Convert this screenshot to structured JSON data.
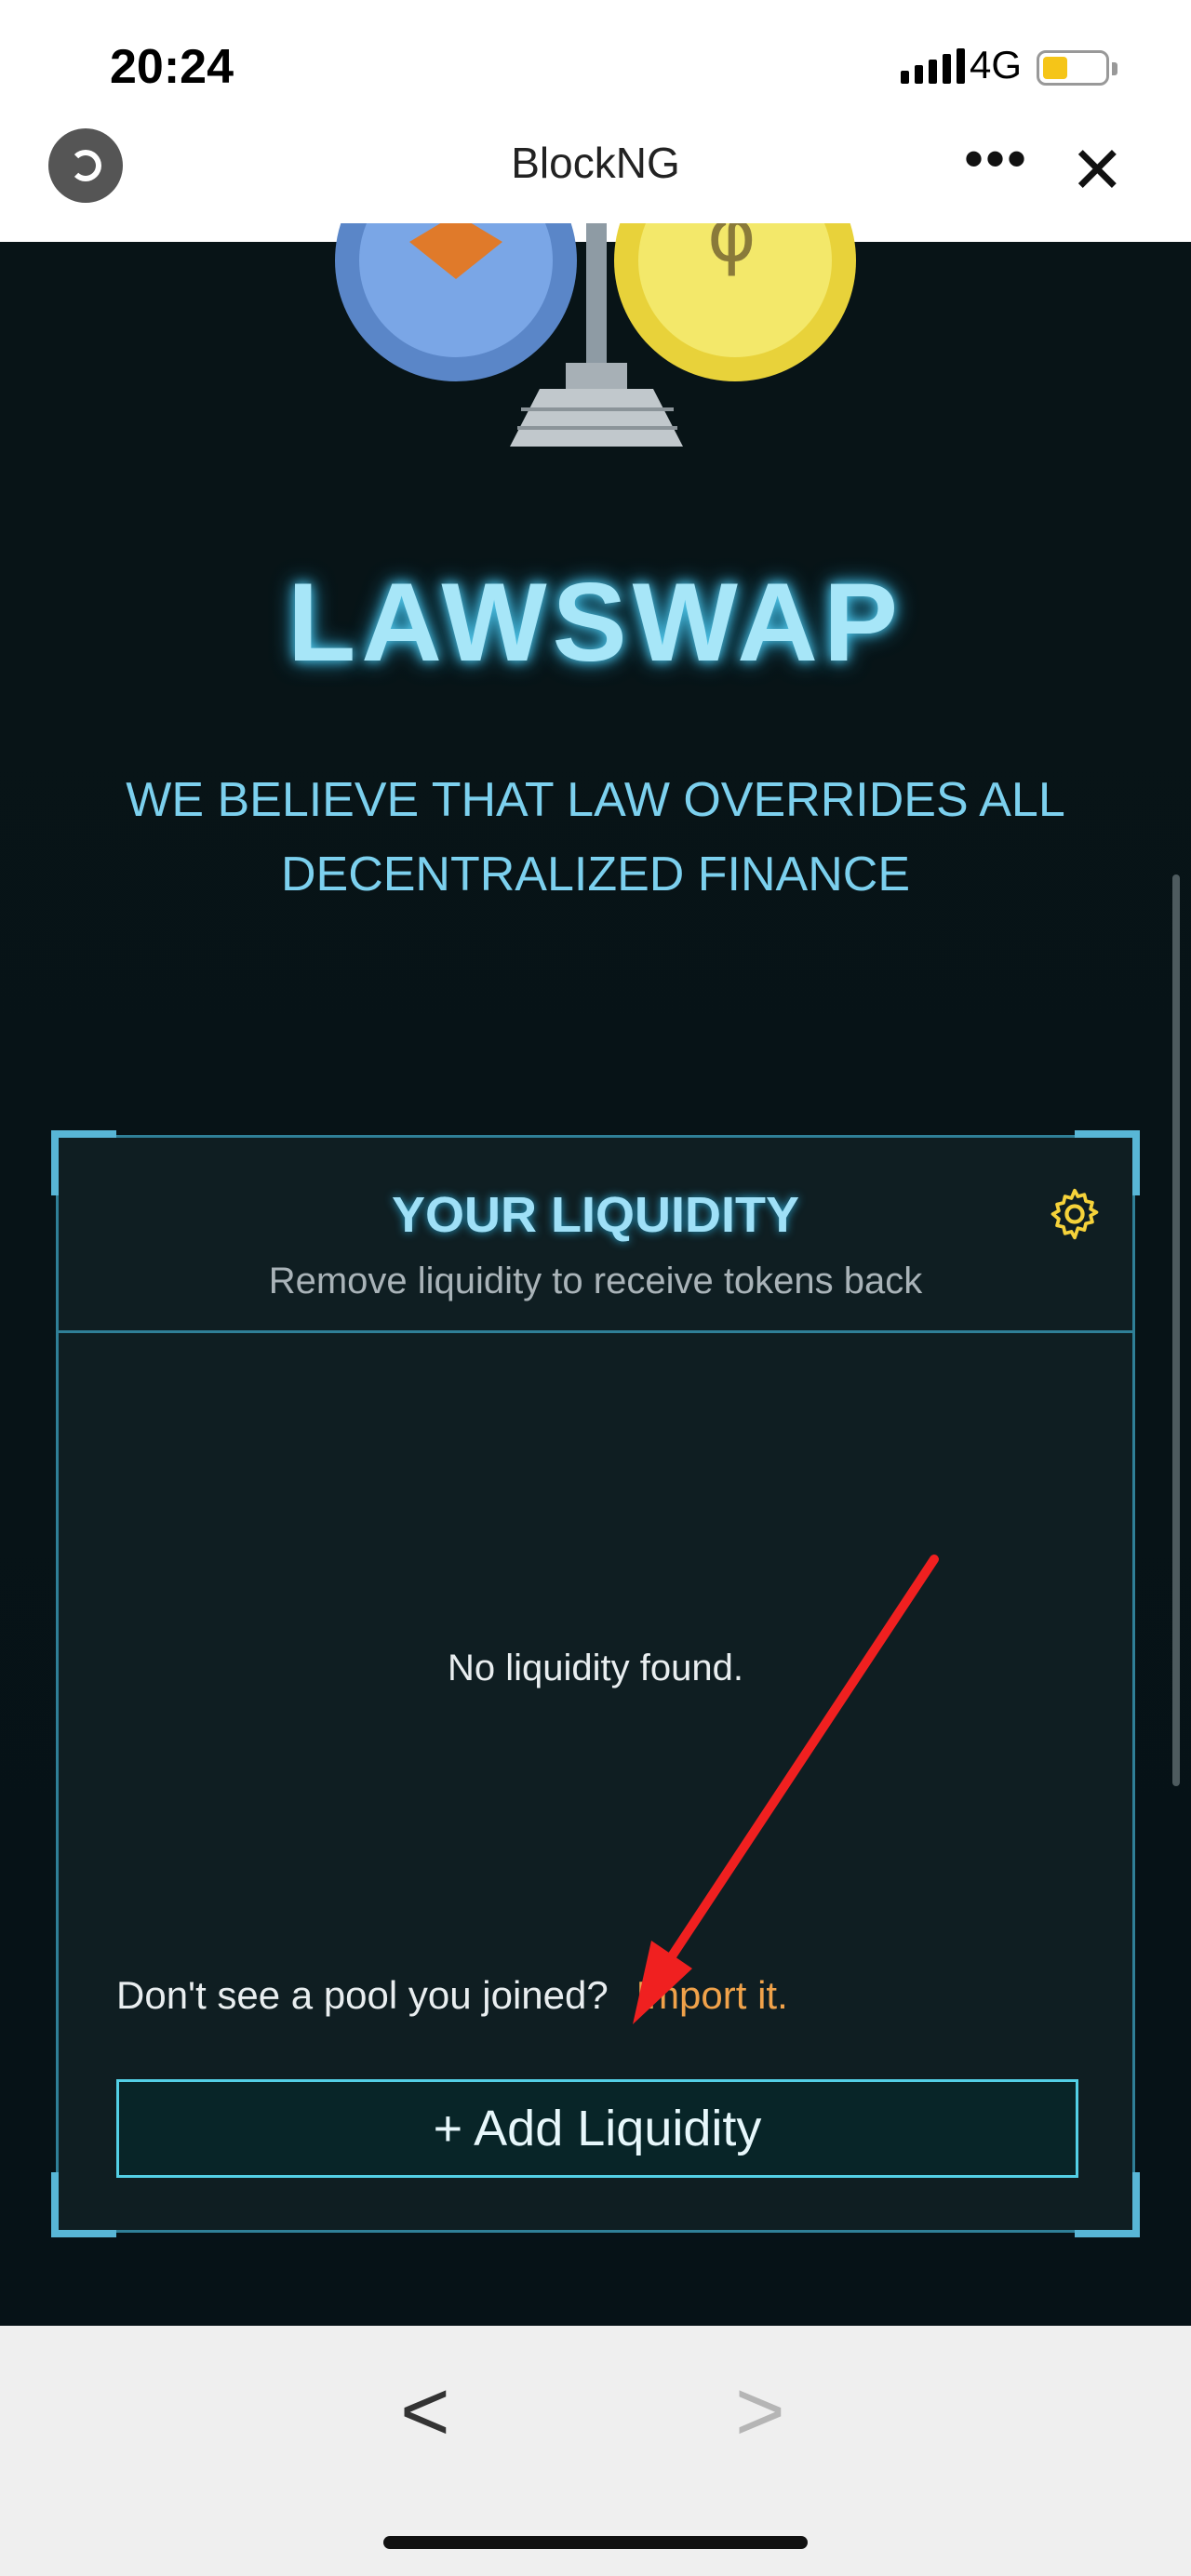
{
  "status": {
    "time": "20:24",
    "network": "4G"
  },
  "nav": {
    "title": "BlockNG"
  },
  "hero": {
    "brand": "LAWSWAP",
    "tagline": "WE BELIEVE THAT LAW OVERRIDES ALL DECENTRALIZED FINANCE"
  },
  "liquidity": {
    "title": "YOUR LIQUIDITY",
    "subtitle": "Remove liquidity to receive tokens back",
    "empty_message": "No liquidity found.",
    "pool_prompt": "Don't see a pool you joined?",
    "import_link": "Import it.",
    "add_button": "+ Add Liquidity"
  },
  "colors": {
    "accent": "#53d0e6",
    "brand_glow": "#a7e6f8",
    "link": "#f0a24a",
    "background": "#081417"
  },
  "icons": [
    "mini-program-icon",
    "more-icon",
    "close-icon",
    "gear-icon",
    "back-chevron-icon",
    "forward-chevron-icon"
  ]
}
